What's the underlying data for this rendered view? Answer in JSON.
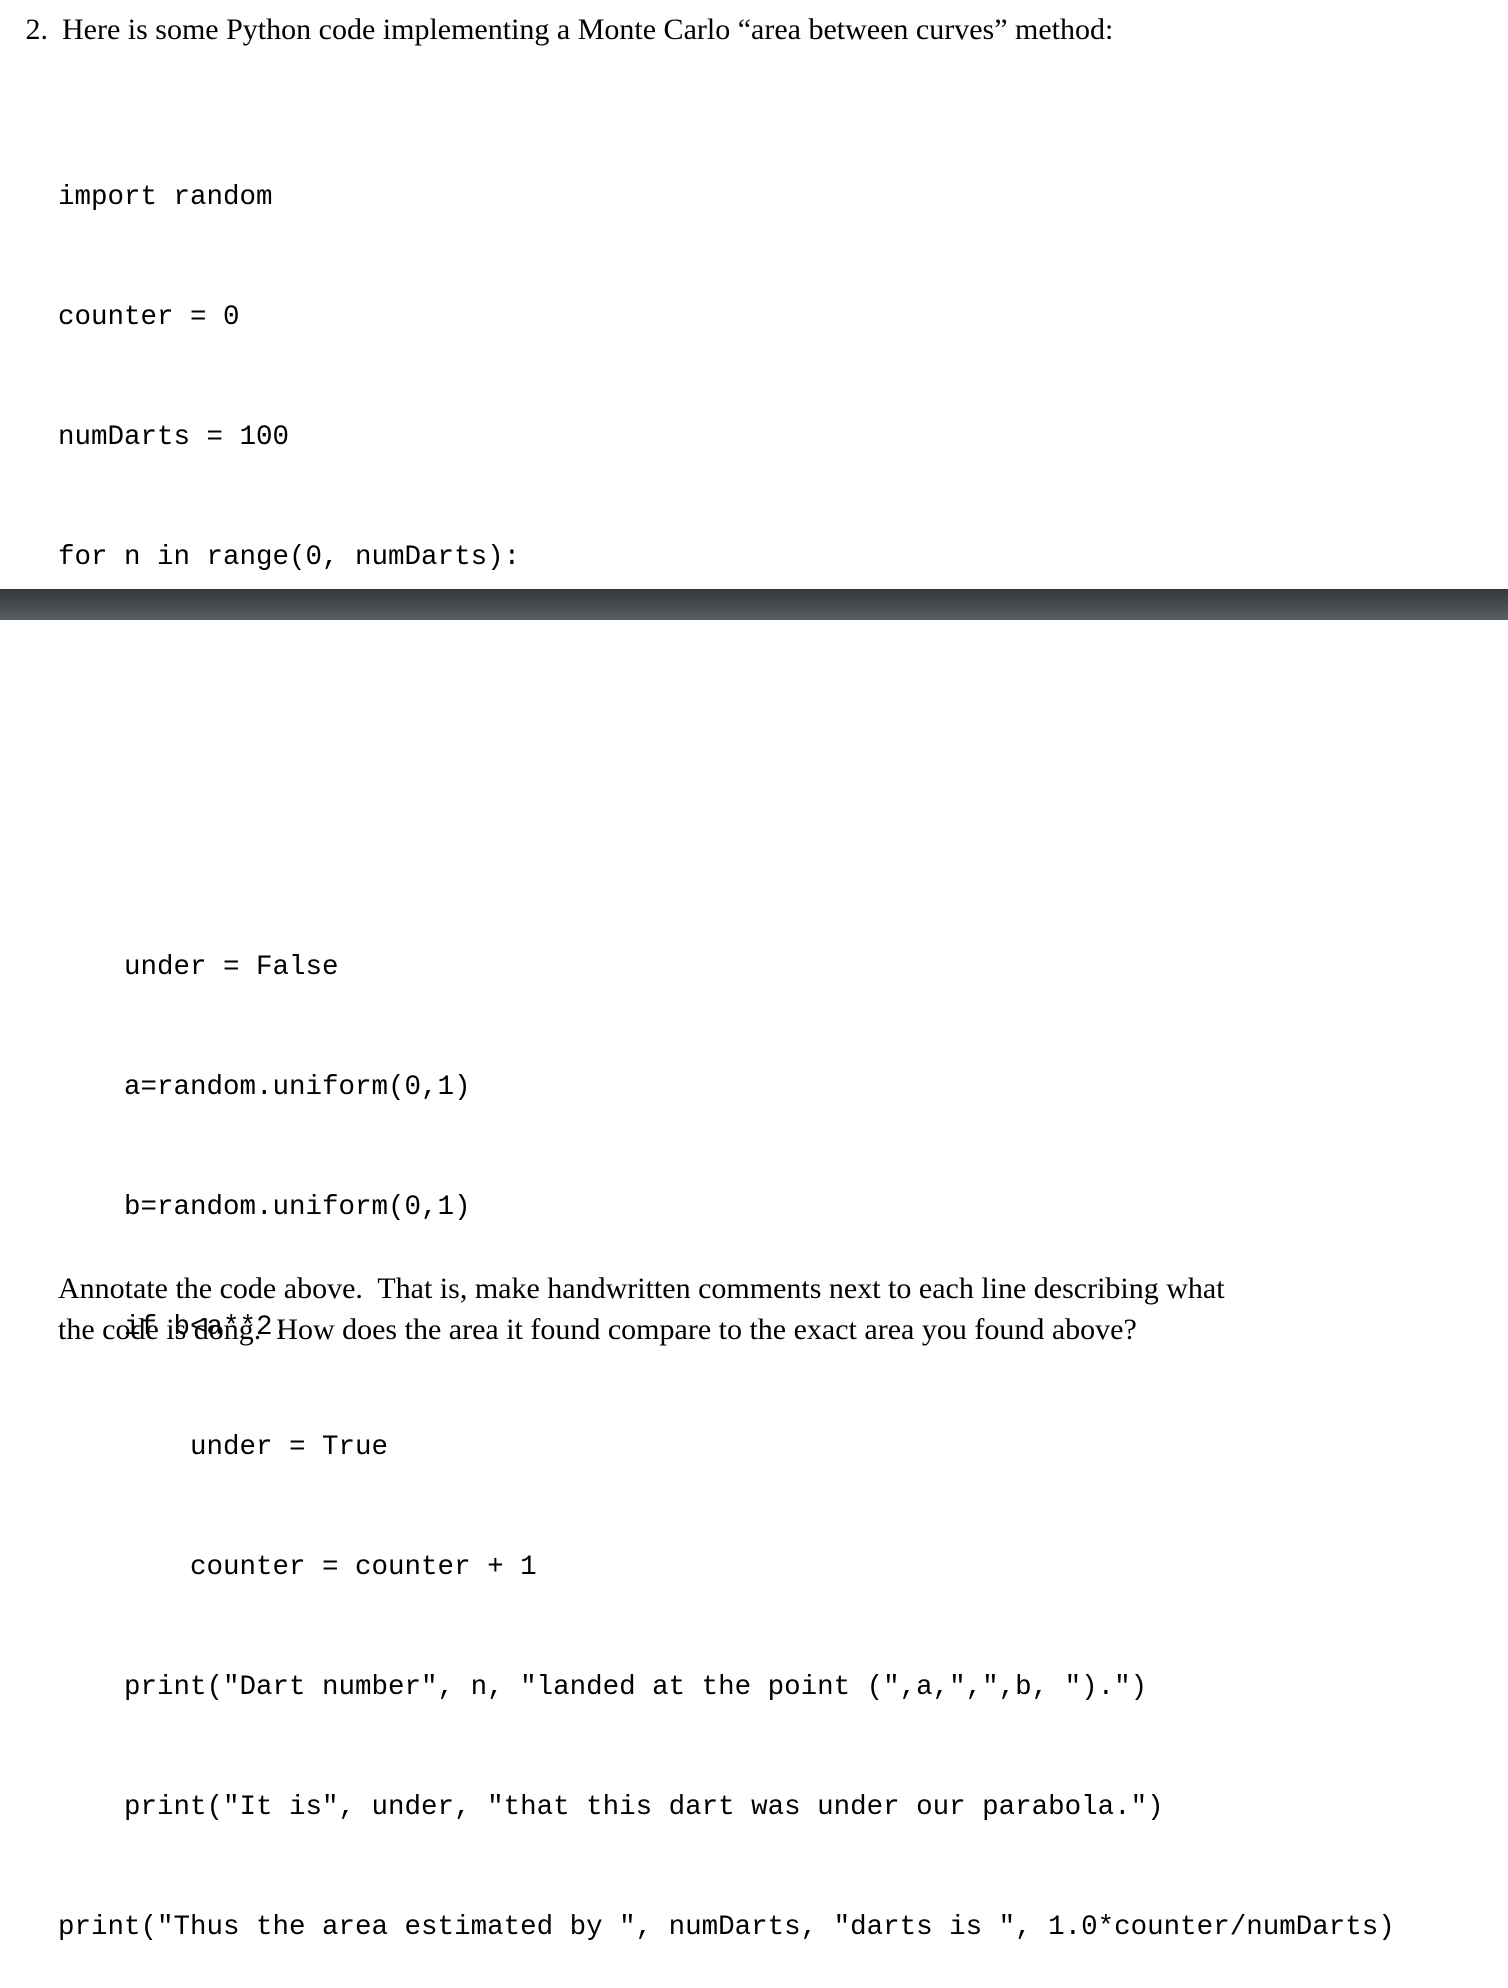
{
  "problem": {
    "number": "2.",
    "prompt": "Here is some Python code implementing a Monte Carlo “area between curves” method:"
  },
  "code_top": {
    "lines": [
      "import random",
      "counter = 0",
      "numDarts = 100",
      "for n in range(0, numDarts):"
    ]
  },
  "code_bottom": {
    "lines": [
      "    under = False",
      "    a=random.uniform(0,1)",
      "    b=random.uniform(0,1)",
      "    if b<a**2:",
      "        under = True",
      "        counter = counter + 1",
      "    print(\"Dart number\", n, \"landed at the point (\",a,\",\",b, \").\")",
      "    print(\"It is\", under, \"that this dart was under our parabola.\")",
      "print(\"Thus the area estimated by \", numDarts, \"darts is \", 1.0*counter/numDarts)"
    ]
  },
  "closing": {
    "line1": "Annotate the code above.  That is, make handwritten comments next to each line describing what",
    "line2": "the code is dong.  How does the area it found compare to the exact area you found above?"
  },
  "artifact": {
    "label": "scan-shadow-bar",
    "color_top": "#34383c",
    "color_bottom": "#5b6165"
  }
}
